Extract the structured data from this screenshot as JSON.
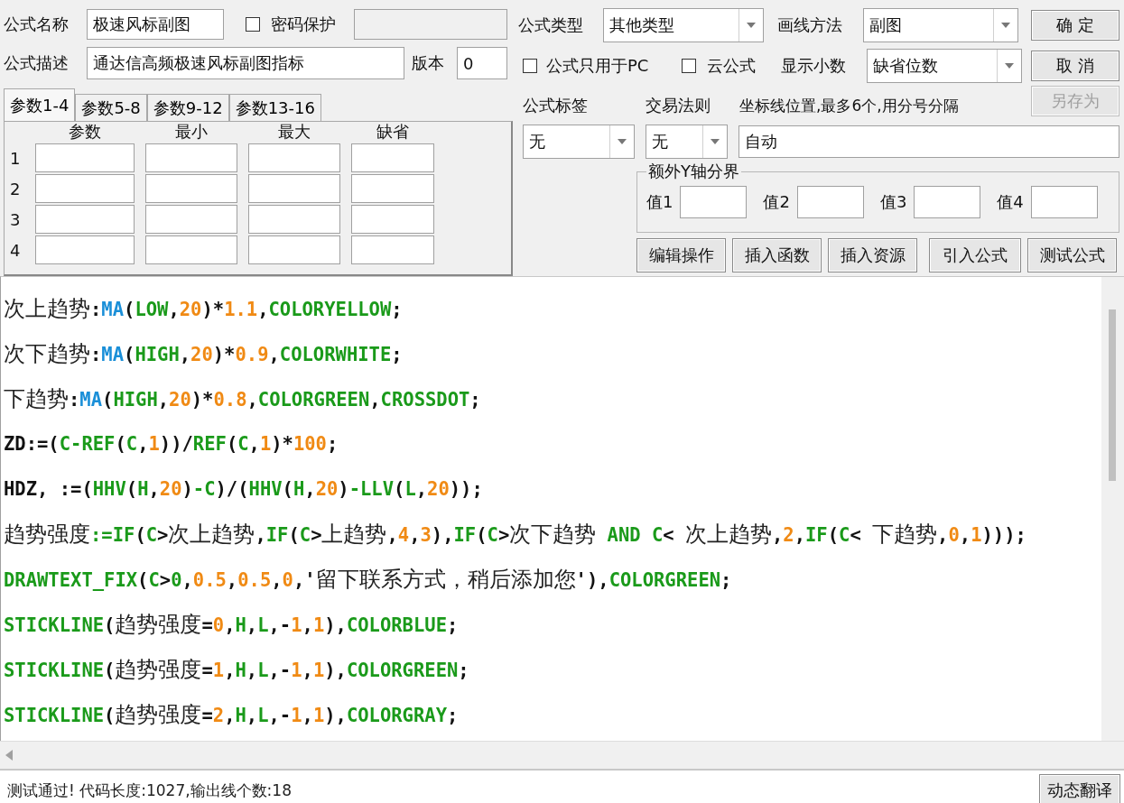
{
  "formula": {
    "name_label": "公式名称",
    "name": "极速风标副图",
    "password": {
      "label": "密码保护",
      "checked": false
    },
    "desc_label": "公式描述",
    "description": "通达信高频极速风标副图指标",
    "version_label": "版本",
    "version": "0",
    "type_label": "公式类型",
    "type": "其他类型",
    "draw_label": "画线方法",
    "draw": "副图",
    "pc_only": {
      "label": "公式只用于PC",
      "checked": false
    },
    "cloud": {
      "label": "云公式",
      "checked": false
    },
    "decimals_label": "显示小数",
    "decimals": "缺省位数"
  },
  "side_buttons": [
    {
      "label": "确 定",
      "disabled": false
    },
    {
      "label": "取 消",
      "disabled": false
    },
    {
      "label": "另存为",
      "disabled": true
    }
  ],
  "param_tabs": [
    {
      "label": "参数1-4",
      "selected": true
    },
    {
      "label": "参数5-8",
      "selected": false
    },
    {
      "label": "参数9-12",
      "selected": false
    },
    {
      "label": "参数13-16",
      "selected": false
    }
  ],
  "param_columns": [
    "参数",
    "最小",
    "最大",
    "缺省"
  ],
  "param_rows": [
    "1",
    "2",
    "3",
    "4"
  ],
  "tag": {
    "label": "公式标签",
    "value": "无"
  },
  "trade_rule": {
    "label": "交易法则",
    "value": "无"
  },
  "axis_lines": {
    "label": "坐标线位置,最多6个,用分号分隔",
    "value": "自动"
  },
  "extra_y": {
    "title": "额外Y轴分界",
    "fields": [
      "值1",
      "值2",
      "值3",
      "值4"
    ]
  },
  "actions": [
    "编辑操作",
    "插入函数",
    "插入资源",
    "引入公式",
    "测试公式"
  ],
  "code_lines": [
    [
      {
        "kind": "cjk",
        "text": "次上趋势"
      },
      {
        "kind": "op",
        "text": ":"
      },
      {
        "kind": "fn",
        "text": "MA"
      },
      {
        "kind": "op",
        "text": "("
      },
      {
        "kind": "kw",
        "text": "LOW"
      },
      {
        "kind": "op",
        "text": ","
      },
      {
        "kind": "num",
        "text": "20"
      },
      {
        "kind": "op",
        "text": ")*"
      },
      {
        "kind": "num",
        "text": "1.1"
      },
      {
        "kind": "op",
        "text": ","
      },
      {
        "kind": "kw",
        "text": "COLORYELLOW"
      },
      {
        "kind": "op",
        "text": ";"
      }
    ],
    [
      {
        "kind": "cjk",
        "text": "次下趋势"
      },
      {
        "kind": "op",
        "text": ":"
      },
      {
        "kind": "fn",
        "text": "MA"
      },
      {
        "kind": "op",
        "text": "("
      },
      {
        "kind": "kw",
        "text": "HIGH"
      },
      {
        "kind": "op",
        "text": ","
      },
      {
        "kind": "num",
        "text": "20"
      },
      {
        "kind": "op",
        "text": ")*"
      },
      {
        "kind": "num",
        "text": "0.9"
      },
      {
        "kind": "op",
        "text": ","
      },
      {
        "kind": "kw",
        "text": "COLORWHITE"
      },
      {
        "kind": "op",
        "text": ";"
      }
    ],
    [
      {
        "kind": "cjk",
        "text": "下趋势"
      },
      {
        "kind": "op",
        "text": ":"
      },
      {
        "kind": "fn",
        "text": "MA"
      },
      {
        "kind": "op",
        "text": "("
      },
      {
        "kind": "kw",
        "text": "HIGH"
      },
      {
        "kind": "op",
        "text": ","
      },
      {
        "kind": "num",
        "text": "20"
      },
      {
        "kind": "op",
        "text": ")*"
      },
      {
        "kind": "num",
        "text": "0.8"
      },
      {
        "kind": "op",
        "text": ","
      },
      {
        "kind": "kw",
        "text": "COLORGREEN"
      },
      {
        "kind": "op",
        "text": ","
      },
      {
        "kind": "kw",
        "text": "CROSSDOT"
      },
      {
        "kind": "op",
        "text": ";"
      }
    ],
    [
      {
        "kind": "op",
        "text": "ZD:=("
      },
      {
        "kind": "kw",
        "text": "C-REF"
      },
      {
        "kind": "op",
        "text": "("
      },
      {
        "kind": "kw",
        "text": "C"
      },
      {
        "kind": "op",
        "text": ","
      },
      {
        "kind": "num",
        "text": "1"
      },
      {
        "kind": "op",
        "text": "))/"
      },
      {
        "kind": "kw",
        "text": "REF"
      },
      {
        "kind": "op",
        "text": "("
      },
      {
        "kind": "kw",
        "text": "C"
      },
      {
        "kind": "op",
        "text": ","
      },
      {
        "kind": "num",
        "text": "1"
      },
      {
        "kind": "op",
        "text": ")*"
      },
      {
        "kind": "num",
        "text": "100"
      },
      {
        "kind": "op",
        "text": ";"
      }
    ],
    [
      {
        "kind": "op",
        "text": "HDZ, :=("
      },
      {
        "kind": "kw",
        "text": "HHV"
      },
      {
        "kind": "op",
        "text": "("
      },
      {
        "kind": "kw",
        "text": "H"
      },
      {
        "kind": "op",
        "text": ","
      },
      {
        "kind": "num",
        "text": "20"
      },
      {
        "kind": "op",
        "text": ")"
      },
      {
        "kind": "kw",
        "text": "-C"
      },
      {
        "kind": "op",
        "text": ")/("
      },
      {
        "kind": "kw",
        "text": "HHV"
      },
      {
        "kind": "op",
        "text": "("
      },
      {
        "kind": "kw",
        "text": "H"
      },
      {
        "kind": "op",
        "text": ","
      },
      {
        "kind": "num",
        "text": "20"
      },
      {
        "kind": "op",
        "text": ")"
      },
      {
        "kind": "kw",
        "text": "-LLV"
      },
      {
        "kind": "op",
        "text": "("
      },
      {
        "kind": "kw",
        "text": "L"
      },
      {
        "kind": "op",
        "text": ","
      },
      {
        "kind": "num",
        "text": "20"
      },
      {
        "kind": "op",
        "text": "));"
      }
    ],
    [
      {
        "kind": "cjk",
        "text": "趋势强度"
      },
      {
        "kind": "kw",
        "text": ":=IF"
      },
      {
        "kind": "op",
        "text": "("
      },
      {
        "kind": "kw",
        "text": "C"
      },
      {
        "kind": "op",
        "text": ">"
      },
      {
        "kind": "cjk",
        "text": "次上趋势"
      },
      {
        "kind": "op",
        "text": ","
      },
      {
        "kind": "kw",
        "text": "IF"
      },
      {
        "kind": "op",
        "text": "("
      },
      {
        "kind": "kw",
        "text": "C"
      },
      {
        "kind": "op",
        "text": ">"
      },
      {
        "kind": "cjk",
        "text": "上趋势"
      },
      {
        "kind": "op",
        "text": ","
      },
      {
        "kind": "num",
        "text": "4"
      },
      {
        "kind": "op",
        "text": ","
      },
      {
        "kind": "num",
        "text": "3"
      },
      {
        "kind": "op",
        "text": "),"
      },
      {
        "kind": "kw",
        "text": "IF"
      },
      {
        "kind": "op",
        "text": "("
      },
      {
        "kind": "kw",
        "text": "C"
      },
      {
        "kind": "op",
        "text": ">"
      },
      {
        "kind": "cjk",
        "text": "次下趋势"
      },
      {
        "kind": "kw",
        "text": " AND C"
      },
      {
        "kind": "op",
        "text": "< "
      },
      {
        "kind": "cjk",
        "text": "次上趋势"
      },
      {
        "kind": "op",
        "text": ","
      },
      {
        "kind": "num",
        "text": "2"
      },
      {
        "kind": "op",
        "text": ","
      },
      {
        "kind": "kw",
        "text": "IF"
      },
      {
        "kind": "op",
        "text": "("
      },
      {
        "kind": "kw",
        "text": "C"
      },
      {
        "kind": "op",
        "text": "< "
      },
      {
        "kind": "cjk",
        "text": "下趋势"
      },
      {
        "kind": "op",
        "text": ","
      },
      {
        "kind": "num",
        "text": "0"
      },
      {
        "kind": "op",
        "text": ","
      },
      {
        "kind": "num",
        "text": "1"
      },
      {
        "kind": "op",
        "text": ")));"
      }
    ],
    [
      {
        "kind": "kw",
        "text": "DRAWTEXT_FIX"
      },
      {
        "kind": "op",
        "text": "("
      },
      {
        "kind": "kw",
        "text": "C"
      },
      {
        "kind": "op",
        "text": ">"
      },
      {
        "kind": "kw",
        "text": "0"
      },
      {
        "kind": "op",
        "text": ","
      },
      {
        "kind": "num",
        "text": "0.5"
      },
      {
        "kind": "op",
        "text": ","
      },
      {
        "kind": "num",
        "text": "0.5"
      },
      {
        "kind": "op",
        "text": ","
      },
      {
        "kind": "num",
        "text": "0"
      },
      {
        "kind": "op",
        "text": ",'"
      },
      {
        "kind": "cjk",
        "text": "留下联系方式，稍后添加您"
      },
      {
        "kind": "op",
        "text": "'),"
      },
      {
        "kind": "kw",
        "text": "COLORGREEN"
      },
      {
        "kind": "op",
        "text": ";"
      }
    ],
    [
      {
        "kind": "kw",
        "text": "STICKLINE"
      },
      {
        "kind": "op",
        "text": "("
      },
      {
        "kind": "cjk",
        "text": "趋势强度"
      },
      {
        "kind": "op",
        "text": "="
      },
      {
        "kind": "num",
        "text": "0"
      },
      {
        "kind": "op",
        "text": ","
      },
      {
        "kind": "kw",
        "text": "H"
      },
      {
        "kind": "op",
        "text": ","
      },
      {
        "kind": "kw",
        "text": "L"
      },
      {
        "kind": "op",
        "text": ",-"
      },
      {
        "kind": "num",
        "text": "1"
      },
      {
        "kind": "op",
        "text": ","
      },
      {
        "kind": "num",
        "text": "1"
      },
      {
        "kind": "op",
        "text": "),"
      },
      {
        "kind": "kw",
        "text": "COLORBLUE"
      },
      {
        "kind": "op",
        "text": ";"
      }
    ],
    [
      {
        "kind": "kw",
        "text": "STICKLINE"
      },
      {
        "kind": "op",
        "text": "("
      },
      {
        "kind": "cjk",
        "text": "趋势强度"
      },
      {
        "kind": "op",
        "text": "="
      },
      {
        "kind": "num",
        "text": "1"
      },
      {
        "kind": "op",
        "text": ","
      },
      {
        "kind": "kw",
        "text": "H"
      },
      {
        "kind": "op",
        "text": ","
      },
      {
        "kind": "kw",
        "text": "L"
      },
      {
        "kind": "op",
        "text": ",-"
      },
      {
        "kind": "num",
        "text": "1"
      },
      {
        "kind": "op",
        "text": ","
      },
      {
        "kind": "num",
        "text": "1"
      },
      {
        "kind": "op",
        "text": "),"
      },
      {
        "kind": "kw",
        "text": "COLORGREEN"
      },
      {
        "kind": "op",
        "text": ";"
      }
    ],
    [
      {
        "kind": "kw",
        "text": "STICKLINE"
      },
      {
        "kind": "op",
        "text": "("
      },
      {
        "kind": "cjk",
        "text": "趋势强度"
      },
      {
        "kind": "op",
        "text": "="
      },
      {
        "kind": "num",
        "text": "2"
      },
      {
        "kind": "op",
        "text": ","
      },
      {
        "kind": "kw",
        "text": "H"
      },
      {
        "kind": "op",
        "text": ","
      },
      {
        "kind": "kw",
        "text": "L"
      },
      {
        "kind": "op",
        "text": ",-"
      },
      {
        "kind": "num",
        "text": "1"
      },
      {
        "kind": "op",
        "text": ","
      },
      {
        "kind": "num",
        "text": "1"
      },
      {
        "kind": "op",
        "text": "),"
      },
      {
        "kind": "kw",
        "text": "COLORGRAY"
      },
      {
        "kind": "op",
        "text": ";"
      }
    ]
  ],
  "status": "测试通过! 代码长度:1027,输出线个数:18",
  "translate_button": "动态翻译"
}
